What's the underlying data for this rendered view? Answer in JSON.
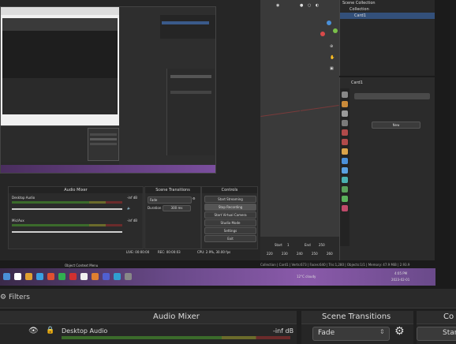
{
  "nested_obs": {
    "mixer_title": "Audio Mixer",
    "transitions_title": "Scene Transitions",
    "controls_title": "Controls",
    "desktop_audio": "Desktop Audio",
    "desktop_db": "-inf dB",
    "mic_aux": "Mic/Aux",
    "mic_db": "-inf dB",
    "transition_value": "Fade",
    "duration_label": "Duration",
    "duration_value": "300 ms",
    "controls": [
      "Start Streaming",
      "Stop Recording",
      "Start Virtual Camera",
      "Studio Mode",
      "Settings",
      "Exit"
    ],
    "status": [
      "LIVE: 00:00:00",
      "REC: 00:00:03",
      "CPU: 2.9%, 30.00 fps"
    ],
    "inner_preview_controls": [
      "Start Streaming",
      "Stop Recording",
      "Start Virtual Camera",
      "Studio Mode",
      "Settings",
      "Exit"
    ]
  },
  "blender": {
    "outliner_title": "Scene Collection",
    "outliner_items": [
      "Collection",
      "Card1"
    ],
    "object_name": "Card1",
    "material_field": "New",
    "timeline_labels": [
      "Start",
      "1",
      "End",
      "250"
    ],
    "ruler": [
      "220",
      "230",
      "240",
      "250",
      "260"
    ],
    "status_bar": "Collection | Card1 | Verts:673 | Faces:640 | Tris:1,280 | Objects:1/1 | Memory: 47.9 MiB | 2.93.9",
    "viewport_controls_color": "#4a90d9"
  },
  "taskbar": {
    "search_text": "Object Context Menu",
    "weather": "12°C cloudy",
    "time": "4:05 PM",
    "date": "2023-02-01",
    "mic_hint": "Mic/Aux",
    "inner_time": "4:05 PM",
    "inner_date": "2023-02-01"
  },
  "outer_obs": {
    "filters_label": "Filters",
    "mixer_title": "Audio Mixer",
    "transitions_title": "Scene Transitions",
    "controls_title_partial": "Co",
    "desktop_audio": "Desktop Audio",
    "desktop_db": "-inf dB",
    "transition_value": "Fade",
    "start_partial": "Start"
  },
  "colors": {
    "accent": "#4a90d9",
    "taskbar": "#5a3d6e",
    "record_red": "#d9534f"
  }
}
